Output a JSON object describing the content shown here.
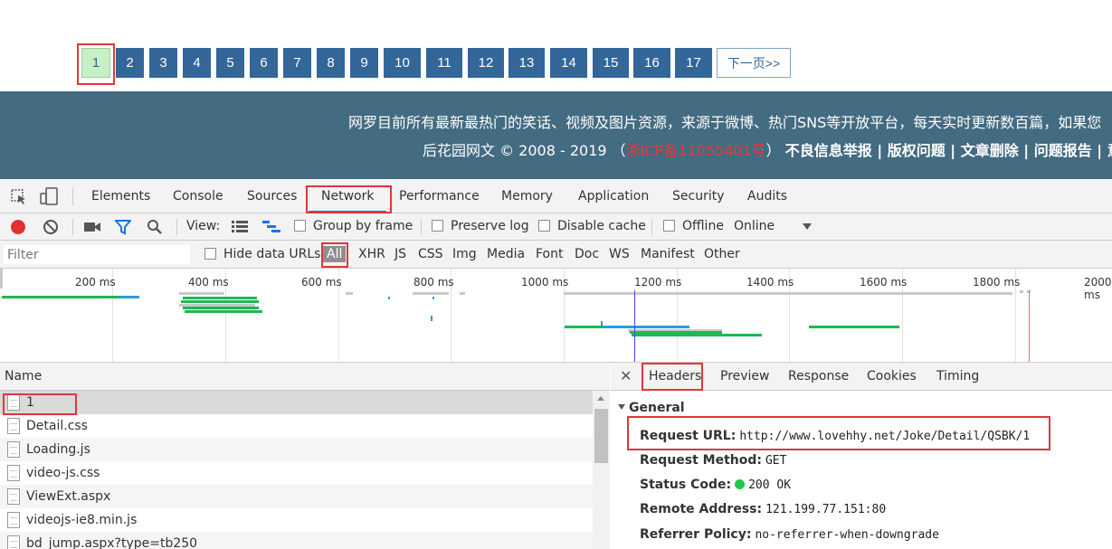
{
  "pager": {
    "pages": [
      "1",
      "2",
      "3",
      "4",
      "5",
      "6",
      "7",
      "8",
      "9",
      "10",
      "11",
      "12",
      "13",
      "14",
      "15",
      "16",
      "17"
    ],
    "current": "1",
    "next_label": "下一页>>"
  },
  "banner": {
    "line1": "网罗目前所有最新最热门的笑话、视频及图片资源，来源于微博、热门SNS等开放平台，每天实时更新数百篇，如果您",
    "copyright": "后花园网文 © 2008 - 2019 （",
    "icp": "浙ICP备11055401号",
    "icp_close": "）",
    "links": "不良信息举报 | 版权问题 | 文章删除 | 问题报告 | 意见建"
  },
  "devtools": {
    "tabs": [
      "Elements",
      "Console",
      "Sources",
      "Network",
      "Performance",
      "Memory",
      "Application",
      "Security",
      "Audits"
    ],
    "active_tab": "Network",
    "toolbar": {
      "view_label": "View:",
      "group_by_frame": "Group by frame",
      "preserve_log": "Preserve log",
      "disable_cache": "Disable cache",
      "offline": "Offline",
      "throttle": "Online"
    },
    "filter": {
      "placeholder": "Filter",
      "hide_data_urls": "Hide data URLs",
      "types": [
        "All",
        "XHR",
        "JS",
        "CSS",
        "Img",
        "Media",
        "Font",
        "Doc",
        "WS",
        "Manifest",
        "Other"
      ],
      "active_type": "All"
    },
    "timeline": {
      "ticks": [
        "200 ms",
        "400 ms",
        "600 ms",
        "800 ms",
        "1000 ms",
        "1200 ms",
        "1400 ms",
        "1600 ms",
        "1800 ms",
        "2000 ms"
      ]
    },
    "requests": {
      "header": "Name",
      "items": [
        "1",
        "Detail.css",
        "Loading.js",
        "video-js.css",
        "ViewExt.aspx",
        "videojs-ie8.min.js",
        "bd_jump.aspx?type=tb250"
      ],
      "selected": "1"
    },
    "detail": {
      "tabs": [
        "Headers",
        "Preview",
        "Response",
        "Cookies",
        "Timing"
      ],
      "active_tab": "Headers",
      "section": "General",
      "fields": [
        {
          "key": "Request URL:",
          "value": "http://www.lovehhy.net/Joke/Detail/QSBK/1"
        },
        {
          "key": "Request Method:",
          "value": "GET"
        },
        {
          "key": "Status Code:",
          "value": "200 OK"
        },
        {
          "key": "Remote Address:",
          "value": "121.199.77.151:80"
        },
        {
          "key": "Referrer Policy:",
          "value": "no-referrer-when-downgrade"
        }
      ]
    }
  },
  "colors": {
    "pager_blue": "#336699",
    "pager_current": "#c7f0c7",
    "banner_bg": "#436b81",
    "highlight_red": "#e0373a",
    "status_green": "#1ec84a"
  }
}
